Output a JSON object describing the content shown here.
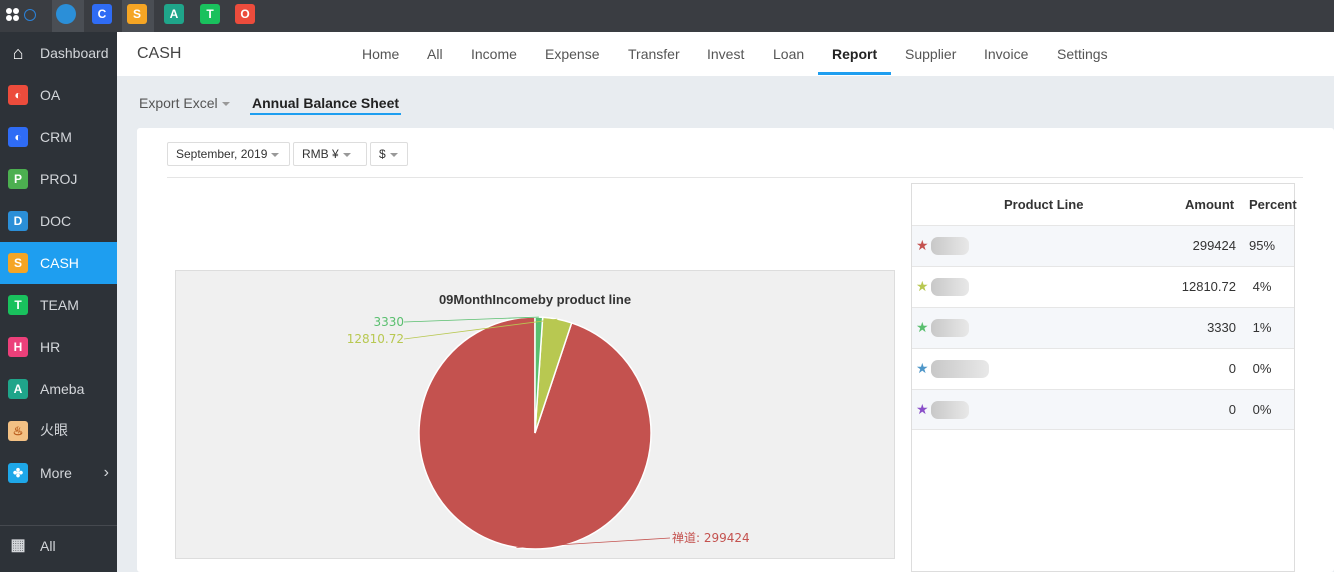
{
  "top_apps": [
    {
      "name": "globe-app-icon",
      "glyph": "",
      "color": "#2b8fd8"
    },
    {
      "name": "crm-app-icon",
      "glyph": "C",
      "color": "#2f6cf5"
    },
    {
      "name": "cash-app-icon",
      "glyph": "S",
      "color": "#f5a524"
    },
    {
      "name": "ameba-app-icon",
      "glyph": "A",
      "color": "#1fa58a"
    },
    {
      "name": "team-app-icon",
      "glyph": "T",
      "color": "#19c15d"
    },
    {
      "name": "oa-app-icon",
      "glyph": "O",
      "color": "#ec4c3c"
    }
  ],
  "sidebar": {
    "items": [
      {
        "label": "Dashboard",
        "icon": "home-icon",
        "color": "#ffffff",
        "glyph": "⌂"
      },
      {
        "label": "OA",
        "icon": "oa-icon",
        "color": "#ec4c3c",
        "glyph": "◐"
      },
      {
        "label": "CRM",
        "icon": "crm-icon",
        "color": "#2f6cf5",
        "glyph": "◐"
      },
      {
        "label": "PROJ",
        "icon": "proj-icon",
        "color": "#4caf50",
        "glyph": "P"
      },
      {
        "label": "DOC",
        "icon": "doc-icon",
        "color": "#2b8fd8",
        "glyph": "D"
      },
      {
        "label": "CASH",
        "icon": "cash-icon",
        "color": "#f5a524",
        "glyph": "S"
      },
      {
        "label": "TEAM",
        "icon": "team-icon",
        "color": "#19c15d",
        "glyph": "T"
      },
      {
        "label": "HR",
        "icon": "hr-icon",
        "color": "#ec407a",
        "glyph": "H"
      },
      {
        "label": "Ameba",
        "icon": "ameba-icon",
        "color": "#1fa58a",
        "glyph": "A"
      },
      {
        "label": "火眼",
        "icon": "fire-eye-icon",
        "color": "#f3c184",
        "glyph": "♨"
      },
      {
        "label": "More",
        "icon": "more-icon",
        "color": "#1ea7e8",
        "glyph": "✤"
      }
    ],
    "all_label": "All",
    "active": "CASH"
  },
  "header": {
    "title": "CASH",
    "nav": [
      "Home",
      "All",
      "Income",
      "Expense",
      "Transfer",
      "Invest",
      "Loan",
      "Report",
      "Supplier",
      "Invoice",
      "Settings"
    ],
    "active_nav": "Report"
  },
  "subtabs": {
    "export": "Export Excel",
    "active": "Annual Balance Sheet"
  },
  "filters": {
    "month": "September, 2019",
    "currency": "RMB ¥",
    "symbol": "$"
  },
  "chart_data": {
    "type": "pie",
    "title": "09MonthIncomeby product line",
    "slices": [
      {
        "label": "禅道: 299424",
        "value": 299424,
        "color": "#c4524f"
      },
      {
        "label": "12810.72",
        "value": 12810.72,
        "color": "#b8c851"
      },
      {
        "label": "3330",
        "value": 3330,
        "color": "#5abf6f"
      },
      {
        "label": "",
        "value": 0,
        "color": "#4f97c9"
      },
      {
        "label": "",
        "value": 0,
        "color": "#8a4fc9"
      }
    ]
  },
  "table": {
    "headers": [
      "Product Line",
      "Amount",
      "Percent"
    ],
    "rows": [
      {
        "amount": "299424",
        "percent": "95%",
        "star_color": "#c4524f"
      },
      {
        "amount": "12810.72",
        "percent": "4%",
        "star_color": "#b8c851"
      },
      {
        "amount": "3330",
        "percent": "1%",
        "star_color": "#5abf6f"
      },
      {
        "amount": "0",
        "percent": "0%",
        "star_color": "#4f97c9"
      },
      {
        "amount": "0",
        "percent": "0%",
        "star_color": "#8a4fc9"
      }
    ]
  }
}
